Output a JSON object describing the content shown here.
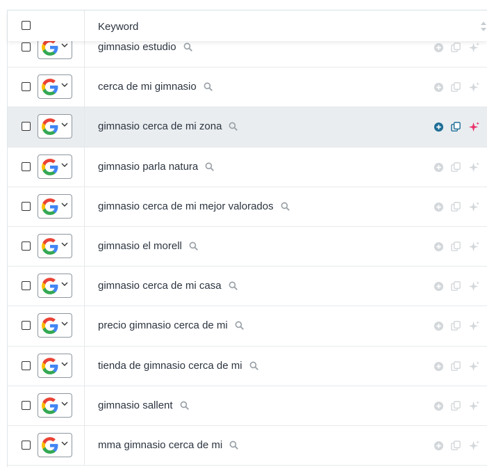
{
  "table": {
    "header": {
      "keyword_label": "Keyword"
    },
    "highlighted_row": 2,
    "colors": {
      "muted_action": "#d3d7da",
      "add_active": "#1f6e96",
      "copy_active": "#1f6e96",
      "ai_active": "#e8336b",
      "row_highlight": "#e9edf0"
    },
    "rows": [
      {
        "keyword": "gimnasio estudio",
        "engine": "google-icon"
      },
      {
        "keyword": "cerca de mi gimnasio",
        "engine": "google-icon"
      },
      {
        "keyword": "gimnasio cerca de mi zona",
        "engine": "google-icon"
      },
      {
        "keyword": "gimnasio parla natura",
        "engine": "google-icon"
      },
      {
        "keyword": "gimnasio cerca de mi mejor valorados",
        "engine": "google-icon"
      },
      {
        "keyword": "gimnasio el morell",
        "engine": "google-icon"
      },
      {
        "keyword": "gimnasio cerca de mi casa",
        "engine": "google-icon"
      },
      {
        "keyword": "precio gimnasio cerca de mi",
        "engine": "google-icon"
      },
      {
        "keyword": "tienda de gimnasio cerca de mi",
        "engine": "google-icon"
      },
      {
        "keyword": "gimnasio sallent",
        "engine": "google-icon"
      },
      {
        "keyword": "mma gimnasio cerca de mi",
        "engine": "google-icon"
      }
    ]
  }
}
